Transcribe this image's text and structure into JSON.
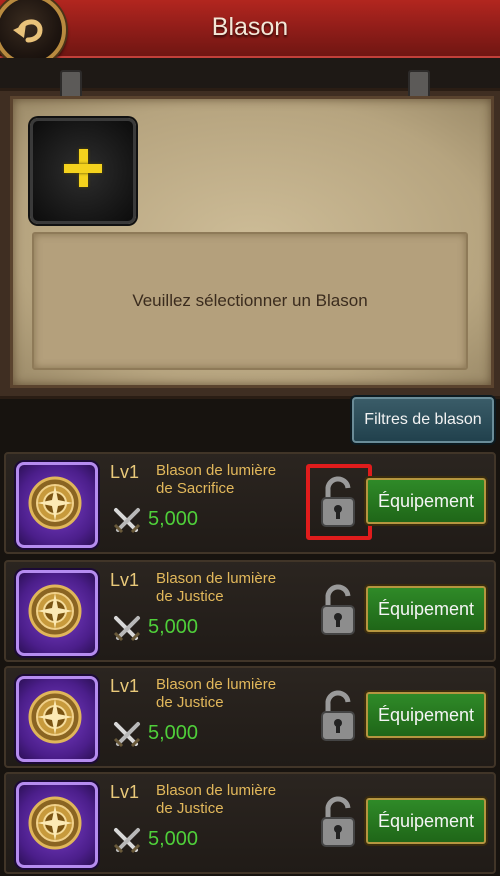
{
  "header": {
    "title": "Blason",
    "back_icon": "back-arrow-icon"
  },
  "panel": {
    "add_slot_icon": "plus-icon",
    "prompt": "Veuillez sélectionner un Blason"
  },
  "filter_button": "Filtres de blason",
  "items": [
    {
      "level": "Lv1",
      "name_line1": "Blason de lumière",
      "name_line2": "de Sacrifice",
      "power": "5,000",
      "lock_icon": "unlocked-padlock-icon",
      "equip_label": "Équipement",
      "highlighted": true
    },
    {
      "level": "Lv1",
      "name_line1": "Blason de lumière",
      "name_line2": "de Justice",
      "power": "5,000",
      "lock_icon": "unlocked-padlock-icon",
      "equip_label": "Équipement",
      "highlighted": false
    },
    {
      "level": "Lv1",
      "name_line1": "Blason de lumière",
      "name_line2": "de Justice",
      "power": "5,000",
      "lock_icon": "unlocked-padlock-icon",
      "equip_label": "Équipement",
      "highlighted": false
    },
    {
      "level": "Lv1",
      "name_line1": "Blason de lumière",
      "name_line2": "de Justice",
      "power": "5,000",
      "lock_icon": "unlocked-padlock-icon",
      "equip_label": "Équipement",
      "highlighted": false
    }
  ],
  "colors": {
    "header": "#9a211b",
    "power_text": "#4fcf3a",
    "equip_button": "#2a7a22",
    "highlight": "#e01c1c"
  }
}
